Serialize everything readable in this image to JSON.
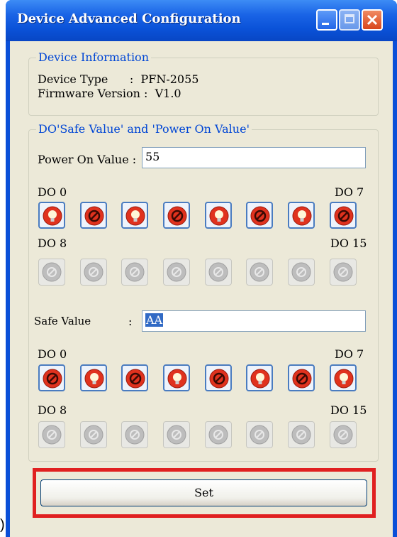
{
  "page_fragment": ")",
  "window": {
    "title": "Device Advanced Configuration",
    "controls": [
      "minimize-icon",
      "maximize-icon",
      "close-icon"
    ]
  },
  "device_info": {
    "legend": "Device Information",
    "type_line": "Device Type      :  PFN-2055",
    "firmware_line": "Firmware Version :  V1.0"
  },
  "do_group": {
    "legend": "DO'Safe Value' and 'Power On Value'",
    "power_on": {
      "label": "Power On Value :",
      "value": "55",
      "do_start_label": "DO 0",
      "do_end_label": "DO 7",
      "do_second_start_label": "DO 8",
      "do_second_end_label": "DO 15",
      "bits_0_7": [
        "on",
        "off",
        "on",
        "off",
        "on",
        "off",
        "on",
        "off"
      ]
    },
    "safe": {
      "label": "Safe Value",
      "colon": ":",
      "value": "AA",
      "do_start_label": "DO 0",
      "do_end_label": "DO 7",
      "do_second_start_label": "DO 8",
      "do_second_end_label": "DO 15",
      "bits_0_7": [
        "off",
        "on",
        "off",
        "on",
        "off",
        "on",
        "off",
        "on"
      ]
    }
  },
  "set_button_label": "Set",
  "colors": {
    "titlebar": "#0a52d8",
    "dialog_bg": "#ece9d8",
    "legend_text": "#0046d5",
    "bit_red": "#e0321e",
    "highlight": "#e02020"
  }
}
